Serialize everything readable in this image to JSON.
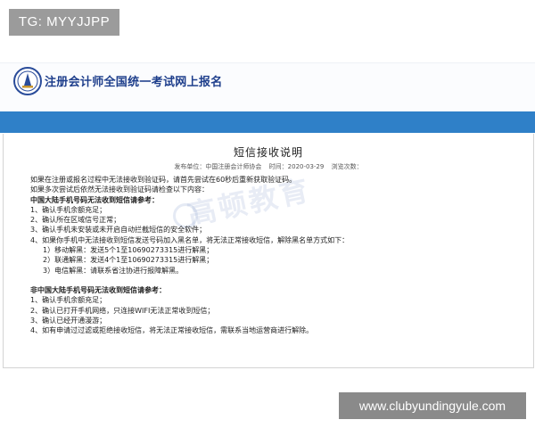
{
  "tg_badge": "TG: MYYJJPP",
  "header": {
    "title": "注册会计师全国统一考试网上报名"
  },
  "notice": {
    "title": "短信接收说明",
    "publisher_label": "发布单位：中国注册会计师协会",
    "time_label": "时间：2020-03-29",
    "views_label": "浏览次数：",
    "watermark": "高顿教育",
    "lines": [
      "如果在注册或报名过程中无法接收到验证码，请首先尝试在60秒后重新获取验证码。",
      "如果多次尝试后依然无法接收到验证码请检查以下内容：",
      "中国大陆手机号码无法收到短信请参考：",
      "1、确认手机余额充足；",
      "2、确认所在区域信号正常；",
      "3、确认手机未安装或未开启自动拦截短信的安全软件；",
      "4、如果你手机中无法接收到短信发送号码加入黑名单，将无法正常接收短信，解除黑名单方式如下：",
      "1）移动解黑：发送5个1至10690273315进行解黑；",
      "2）联通解黑：发送4个1至10690273315进行解黑；",
      "3）电信解黑：请联系省注协进行报障解黑。",
      "非中国大陆手机号码无法收到短信请参考：",
      "1、确认手机余额充足；",
      "2、确认已打开手机网络，只连接WIFI无法正常收到短信；",
      "3、确认已经开通漫游；",
      "4、如有申请过过滤或拒绝接收短信，将无法正常接收短信，需联系当地运营商进行解除。"
    ]
  },
  "site_badge": "www.clubyundingyule.com",
  "colors": {
    "header_title": "#1f3f8c",
    "blue_bar": "#2f80c8",
    "badge_bg": "#9b9b9b"
  }
}
